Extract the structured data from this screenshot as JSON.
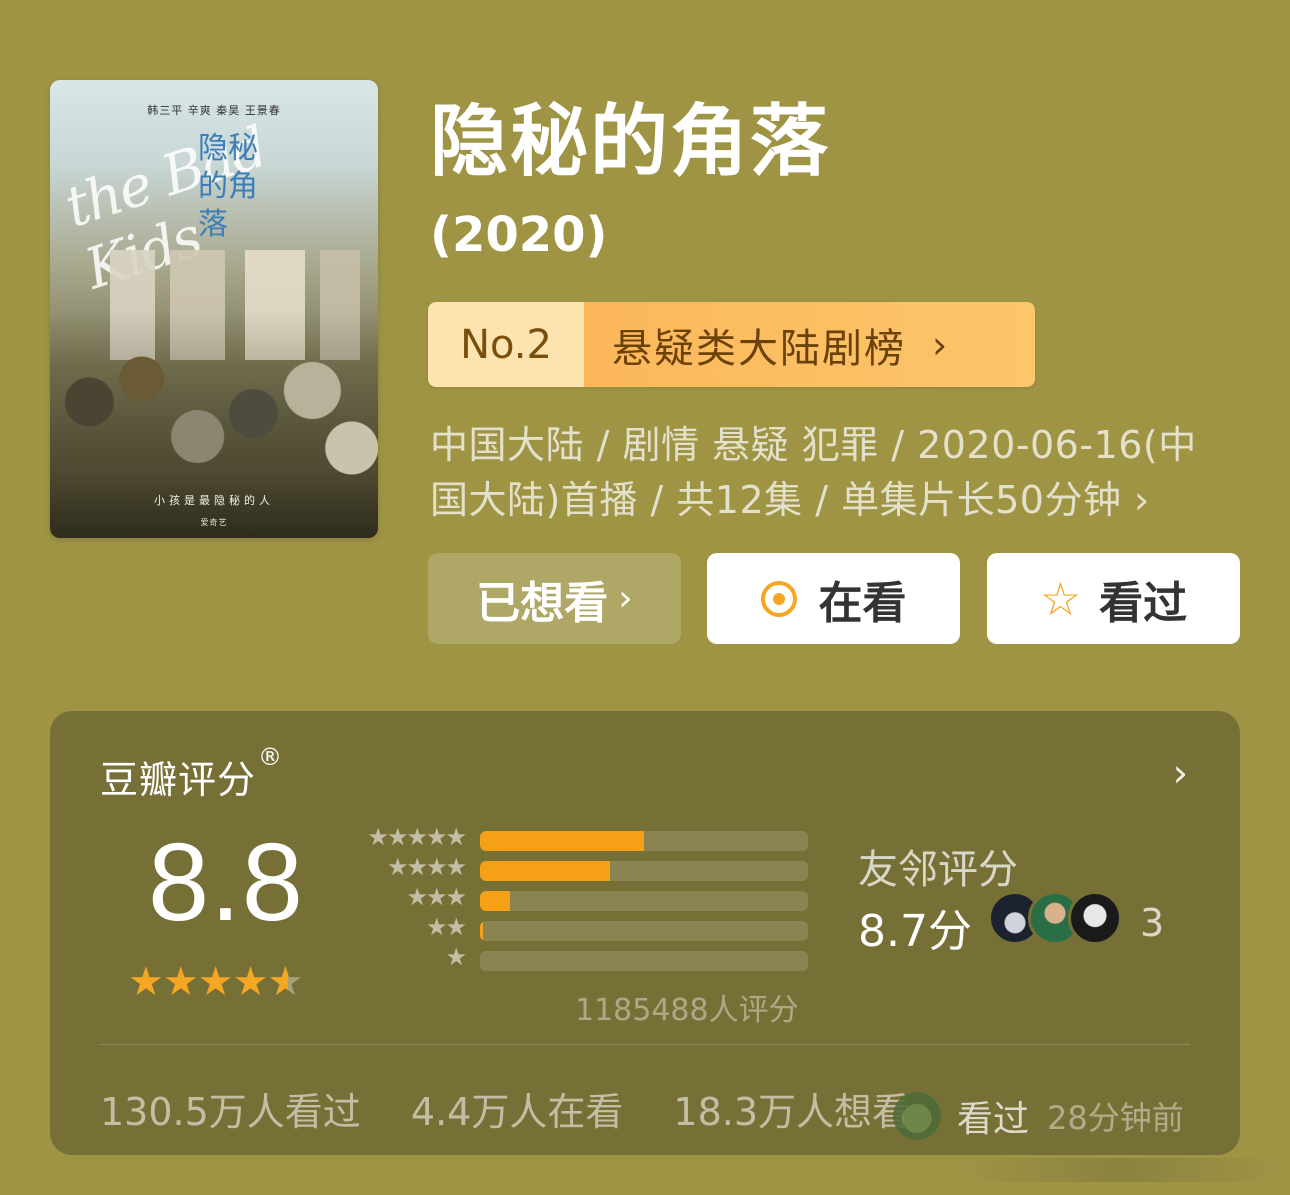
{
  "poster": {
    "cast_line": "韩三平  辛爽  秦昊  王景春",
    "script_title": "the Bad Kids",
    "cn_title": "隐秘的角落",
    "tagline": "小孩是最隐秘的人",
    "sponsors": "爱奇艺"
  },
  "show": {
    "title": "隐秘的角落",
    "year": "(2020)",
    "rank_no": "No.2",
    "rank_label": "悬疑类大陆剧榜",
    "rank_chevron": "›",
    "meta": "中国大陆 / 剧情 悬疑 犯罪 / 2020-06-16(中国大陆)首播 / 共12集 / 单集片长50分钟 ›"
  },
  "actions": {
    "want_label": "已想看",
    "want_chevron": "›",
    "watching_label": "在看",
    "watched_label": "看过",
    "watched_icon": "☆"
  },
  "rating": {
    "title": "豆瓣评分",
    "registered": "®",
    "arrow": "›",
    "score": "8.8",
    "stars_full": "★★★★",
    "stars_half": "★",
    "count_text": "1185488人评分",
    "distribution": [
      {
        "stars": "★★★★★",
        "fraction": 0.5
      },
      {
        "stars": "★★★★",
        "fraction": 0.395
      },
      {
        "stars": "★★★",
        "fraction": 0.09
      },
      {
        "stars": "★★",
        "fraction": 0.008
      },
      {
        "stars": "★",
        "fraction": 0.0
      }
    ],
    "friends_title": "友邻评分",
    "friends_score": "8.7分",
    "friends_count": "3"
  },
  "stats": {
    "watched": "130.5万人看过",
    "watching": "4.4万人在看",
    "want": "18.3万人想看"
  },
  "toast": {
    "label": "看过",
    "time": "28分钟前"
  },
  "colors": {
    "background": "#9e9444",
    "card": "#777036",
    "accent": "#f5a623",
    "rank_badge": "#fcb75a"
  }
}
